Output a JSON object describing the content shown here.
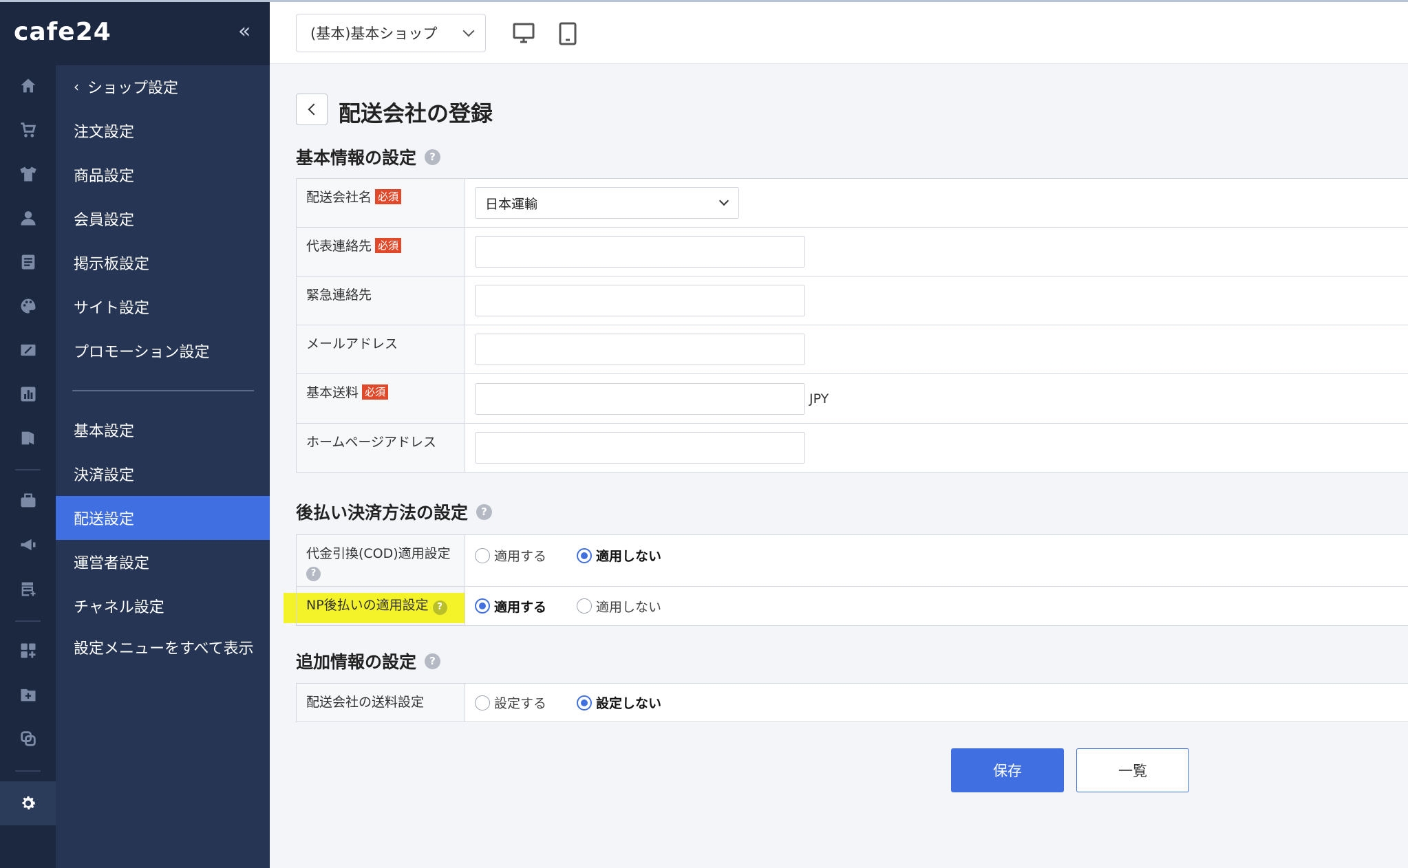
{
  "brand": {
    "logo": "cafe24",
    "collapse_label": "«"
  },
  "rail": {
    "icons": [
      "home-icon",
      "cart-icon",
      "tshirt-icon",
      "user-icon",
      "board-icon",
      "palette-icon",
      "coupon-icon",
      "chart-icon",
      "exit-icon",
      "briefcase-icon",
      "megaphone-icon",
      "store-add-icon",
      "apps-add-icon",
      "folder-add-icon",
      "link-icon",
      "gear-icon"
    ],
    "active": "gear-icon"
  },
  "menu": {
    "back_label": "ショップ設定",
    "items_top": [
      "注文設定",
      "商品設定",
      "会員設定",
      "掲示板設定",
      "サイト設定",
      "プロモーション設定"
    ],
    "items_bottom": [
      "基本設定",
      "決済設定",
      "配送設定",
      "運営者設定",
      "チャネル設定"
    ],
    "show_all": "設定メニューをすべて表示",
    "active_item": "配送設定"
  },
  "topbar": {
    "shop_select": "(基本)基本ショップ"
  },
  "page": {
    "title": "配送会社の登録"
  },
  "section_basic": {
    "title": "基本情報の設定",
    "help": "?",
    "required_badge": "必須",
    "rows": {
      "company_name": {
        "label": "配送会社名",
        "value": "日本運輸"
      },
      "phone": {
        "label": "代表連絡先",
        "value": ""
      },
      "emergency": {
        "label": "緊急連絡先",
        "value": ""
      },
      "email": {
        "label": "メールアドレス",
        "value": ""
      },
      "fee": {
        "label": "基本送料",
        "value": "",
        "unit": "JPY"
      },
      "homepage": {
        "label": "ホームページアドレス",
        "value": ""
      }
    }
  },
  "section_payment": {
    "title": "後払い決済方法の設定",
    "help": "?",
    "rows": {
      "cod": {
        "label": "代金引換(COD)適用設定",
        "help": "?",
        "opt_apply": "適用する",
        "opt_not": "適用しない",
        "selected": "適用しない"
      },
      "np": {
        "label": "NP後払いの適用設定",
        "help": "?",
        "opt_apply": "適用する",
        "opt_not": "適用しない",
        "selected": "適用する"
      }
    }
  },
  "section_extra": {
    "title": "追加情報の設定",
    "help": "?",
    "rows": {
      "shipping_fee": {
        "label": "配送会社の送料設定",
        "opt_set": "設定する",
        "opt_not": "設定しない",
        "selected": "設定しない"
      }
    }
  },
  "actions": {
    "save": "保存",
    "list": "一覧"
  },
  "colors": {
    "accent": "#3f6fe0",
    "sidebar": "#253553",
    "rail": "#1c2840",
    "required": "#e04a2a",
    "highlight": "#f4f32a"
  }
}
